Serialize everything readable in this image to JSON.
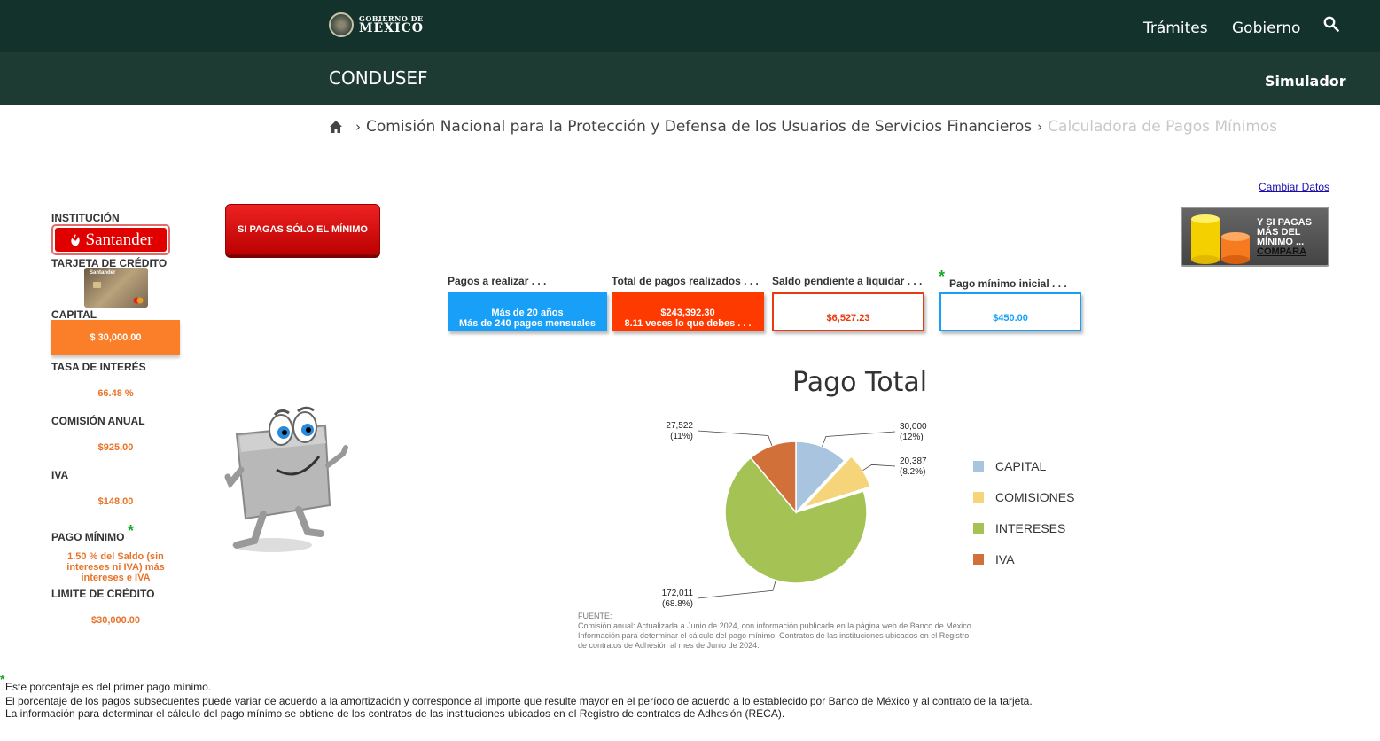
{
  "header": {
    "logo_small": "GOBIERNO DE",
    "logo_big": "MÉXICO",
    "nav": [
      "Trámites",
      "Gobierno"
    ],
    "search_icon": "search-icon"
  },
  "subheader": {
    "title": "CONDUSEF",
    "simulador": "Simulador"
  },
  "breadcrumb": {
    "home_icon": "home-icon",
    "link": "Comisión Nacional para la Protección y Defensa de los Usuarios de Servicios Financieros",
    "current": "Calculadora de Pagos Mínimos"
  },
  "cambiar_datos": "Cambiar Datos",
  "sidebar": {
    "institucion_label": "INSTITUCIÓN",
    "bank_name": "Santander",
    "tarjeta_label": "TARJETA DE CRÉDITO",
    "card_brand": "Santander",
    "capital_label": "CAPITAL",
    "capital_value": "$ 30,000.00",
    "tasa_label": "TASA DE INTERÉS",
    "tasa_value": "66.48 %",
    "comision_label": "COMISIÓN ANUAL",
    "comision_value": "$925.00",
    "iva_label": "IVA",
    "iva_value": "$148.00",
    "pago_minimo_label": "PAGO MÍNIMO",
    "asterisk": "*",
    "pago_minimo_value": "1.50 % del Saldo (sin intereses ni IVA) más intereses e IVA",
    "limite_label": "LIMITE DE CRÉDITO",
    "limite_value": "$30,000.00"
  },
  "buttons": {
    "si_pagas": "SI PAGAS SÓLO EL MÍNIMO",
    "compara_line1": "Y SI PAGAS",
    "compara_line2": "MÁS DEL",
    "compara_line3": "MÍNIMO ...",
    "compara_line4": "COMPARA"
  },
  "results": {
    "pagos_label": "Pagos a realizar . . .",
    "pagos_line1": "Más de 20 años",
    "pagos_line2": "Más de 240 pagos mensuales",
    "total_label": "Total de pagos realizados . . .",
    "total_line1": "$243,392.30",
    "total_line2": "8.11 veces lo que debes . . .",
    "saldo_label": "Saldo pendiente a liquidar . . .",
    "saldo_value": "$6,527.23",
    "pago_min_label": "Pago mínimo inicial . . .",
    "pago_min_value": "$450.00",
    "asterisk": "*"
  },
  "chart_data": {
    "type": "pie",
    "title": "Pago Total",
    "categories": [
      "CAPITAL",
      "COMISIONES",
      "INTERESES",
      "IVA"
    ],
    "values": [
      30000,
      20387,
      172011,
      27522
    ],
    "labels": [
      "30,000",
      "20,387",
      "172,011",
      "27,522"
    ],
    "percents": [
      "(12%)",
      "(8.2%)",
      "(68.8%)",
      "(11%)"
    ],
    "colors": [
      "#a9c4df",
      "#f5d47a",
      "#a5c255",
      "#d2703a"
    ],
    "exploded": "COMISIONES",
    "legend": "right"
  },
  "fuente": {
    "l1": "FUENTE:",
    "l2": "Comisión anual: Actualizada a Junio de 2024, con información publicada en la página web de Banco de México.",
    "l3": "Información para determinar el cálculo del pago mínimo: Contratos de las instituciones ubicados en el Registro de contratos de Adhesión al mes de Junio de 2024."
  },
  "footnotes": {
    "asterisk": "*",
    "n1": "Este porcentaje es del primer pago mínimo.",
    "n2": "El porcentaje de los pagos subsecuentes puede variar de acuerdo a la amortización y corresponde al importe que resulte mayor en el período de acuerdo a lo establecido por Banco de México y al contrato de la tarjeta.",
    "n3": "La información para determinar el cálculo del pago mínimo se obtiene de los contratos de las instituciones ubicados en el Registro de contratos de Adhesión (RECA)."
  }
}
